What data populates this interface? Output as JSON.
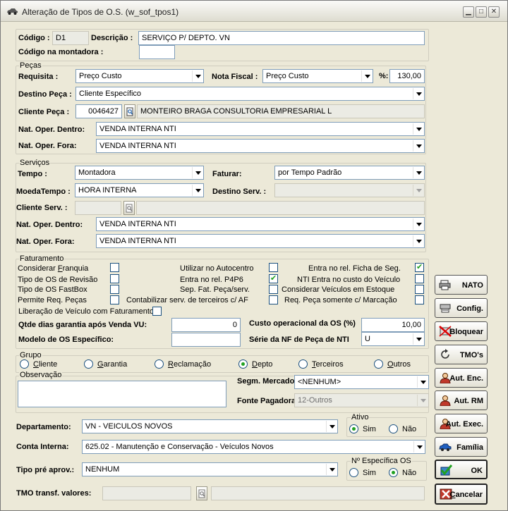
{
  "window": {
    "title": "Alteração de Tipos de O.S. (w_sof_tpos1)"
  },
  "header": {
    "codigo_label": "Código :",
    "codigo_value": "D1",
    "descricao_label": "Descrição :",
    "descricao_value": "SERVIÇO P/ DEPTO. VN",
    "codigo_montadora_label": "Código na montadora :",
    "codigo_montadora_value": ""
  },
  "pecas": {
    "group_title": "Peças",
    "requisita_label": "Requisita :",
    "requisita_value": "Preço Custo",
    "nota_fiscal_label": "Nota Fiscal :",
    "nota_fiscal_value": "Preço Custo",
    "percent_label": "%:",
    "percent_value": "130,00",
    "destino_label": "Destino Peça :",
    "destino_value": "Cliente Específico",
    "cliente_label": "Cliente Peça :",
    "cliente_code": "0046427",
    "cliente_name": "MONTEIRO BRAGA CONSULTORIA EMPRESARIAL L",
    "nat_dentro_label": "Nat. Oper. Dentro:",
    "nat_dentro_value": "VENDA INTERNA NTI",
    "nat_fora_label": "Nat. Oper. Fora:",
    "nat_fora_value": "VENDA INTERNA NTI"
  },
  "servicos": {
    "group_title": "Serviços",
    "tempo_label": "Tempo :",
    "tempo_value": "Montadora",
    "faturar_label": "Faturar:",
    "faturar_value": "por Tempo Padrão",
    "moeda_label": "MoedaTempo :",
    "moeda_value": "HORA  INTERNA",
    "destino_label": "Destino Serv. :",
    "destino_value": "",
    "cliente_label": "Cliente Serv. :",
    "cliente_code": "",
    "cliente_name": "",
    "nat_dentro_label": "Nat. Oper. Dentro:",
    "nat_dentro_value": "VENDA INTERNA NTI",
    "nat_fora_label": "Nat. Oper. Fora:",
    "nat_fora_value": "VENDA INTERNA NTI"
  },
  "faturamento": {
    "group_title": "Faturamento",
    "checks": [
      {
        "label_pre": "Considerar ",
        "label_u": "F",
        "label_post": "ranquia",
        "checked": false
      },
      {
        "label": "Tipo de OS de Revisão",
        "checked": false
      },
      {
        "label": "Tipo de OS FastBox",
        "checked": false
      },
      {
        "label": "Permite Req. Peças",
        "checked": false
      },
      {
        "label": "Utilizar no Autocentro",
        "checked": false
      },
      {
        "label": "Entra no rel. P4P6",
        "checked": true
      },
      {
        "label": "Sep. Fat. Peça/serv.",
        "checked": false
      },
      {
        "label": "Contabilizar serv. de terceiros c/ AF",
        "checked": false
      },
      {
        "label": "Entra no rel. Ficha de Seg.",
        "checked": true
      },
      {
        "label": "NTI Entra no custo do Veículo",
        "checked": false
      },
      {
        "label": "Considerar Veículos em Estoque",
        "checked": false
      },
      {
        "label": "Req. Peça somente c/ Marcação",
        "checked": false
      },
      {
        "label": "Liberação de Veículo com Faturamento",
        "checked": false
      }
    ],
    "garantia_label": "Qtde dias garantia após Venda VU:",
    "garantia_value": "0",
    "custo_label": "Custo operacional da OS (%)",
    "custo_value": "10,00",
    "modelo_label": "Modelo de OS Específico:",
    "modelo_value": "",
    "serie_label": "Série da NF de Peça de NTI",
    "serie_value": "U"
  },
  "grupo": {
    "group_title": "Grupo",
    "options": [
      {
        "label": "Cliente",
        "u": "C",
        "checked": false
      },
      {
        "label": "Garantia",
        "u": "G",
        "checked": false
      },
      {
        "label": "Reclamação",
        "u": "R",
        "checked": false
      },
      {
        "label": "Depto",
        "u": "D",
        "checked": true
      },
      {
        "label": "Terceiros",
        "u": "T",
        "checked": false
      },
      {
        "label": "Outros",
        "u": "O",
        "checked": false
      }
    ]
  },
  "observacao": {
    "label": "Observação",
    "value": ""
  },
  "segm_label": "Segm. Mercado:",
  "segm_value": "<NENHUM>",
  "fonte_label": "Fonte Pagadora:",
  "fonte_value": "12-Outros",
  "departamento_label": "Departamento:",
  "departamento_value": "VN - VEICULOS NOVOS",
  "ativo": {
    "title": "Ativo",
    "sim": "Sim",
    "nao": "Não",
    "selected": "sim"
  },
  "conta_label": "Conta Interna:",
  "conta_value": "625.02 - Manutenção e Conservação - Veículos Novos",
  "tipo_pre_label": "Tipo pré aprov.:",
  "tipo_pre_value": "NENHUM",
  "especifica": {
    "title": "Nº Específica OS",
    "sim": "Sim",
    "nao": "Não",
    "selected": "nao"
  },
  "tmo_label": "TMO transf. valores:",
  "tmo_code": "",
  "tmo_name": "",
  "side_buttons": [
    {
      "label": "NATO",
      "icon": "printer-icon"
    },
    {
      "label": "Config.",
      "icon": "config-icon"
    },
    {
      "label": "Bloquear",
      "icon": "block-icon"
    },
    {
      "label": "TMO's",
      "icon": "refresh-icon"
    },
    {
      "label": "Aut. Enc.",
      "icon": "user-icon"
    },
    {
      "label": "Aut. RM",
      "icon": "user-icon"
    },
    {
      "label": "Aut. Exec.",
      "icon": "user-icon"
    },
    {
      "label": "Família",
      "icon": "car-icon"
    },
    {
      "label": "OK",
      "icon": "ok-icon"
    },
    {
      "label": "Cancelar",
      "icon": "cancel-icon"
    }
  ]
}
